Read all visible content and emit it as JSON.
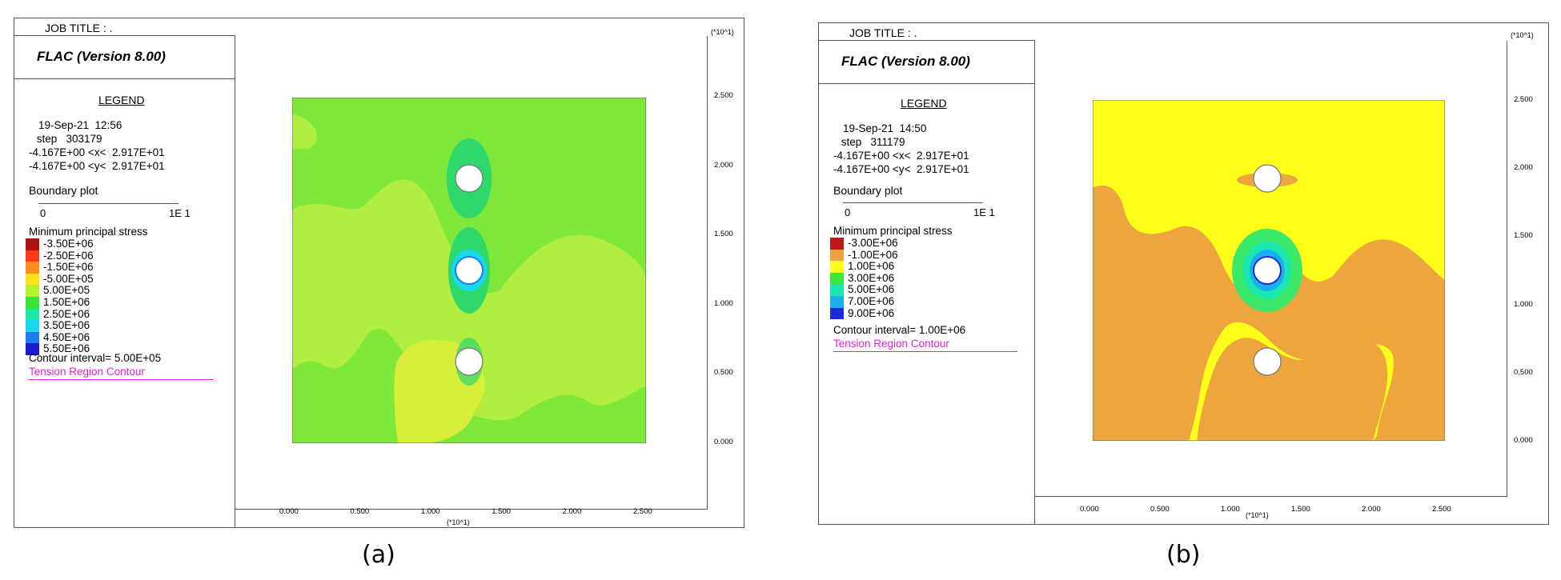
{
  "captions": [
    "(a)",
    "(b)"
  ],
  "panels": [
    {
      "job_title": "JOB TITLE : .",
      "app_title": "FLAC (Version 8.00)",
      "legend_title": "LEGEND",
      "info_lines": [
        "19-Sep-21  12:56",
        " step   303179",
        "-4.167E+00 <x<  2.917E+01",
        "-4.167E+00 <y<  2.917E+01"
      ],
      "boundary_label": "Boundary plot",
      "scale_left": "0",
      "scale_right": "1E  1",
      "stress_title": "Minimum principal stress",
      "levels": [
        {
          "label": "-3.50E+06",
          "color": "#b01010"
        },
        {
          "label": "-2.50E+06",
          "color": "#ff3a1a"
        },
        {
          "label": "-1.50E+06",
          "color": "#ff8c1a"
        },
        {
          "label": "-5.00E+05",
          "color": "#ffe21a"
        },
        {
          "label": "5.00E+05",
          "color": "#b6f230"
        },
        {
          "label": "1.50E+06",
          "color": "#38e63a"
        },
        {
          "label": "2.50E+06",
          "color": "#1ae8a8"
        },
        {
          "label": "3.50E+06",
          "color": "#1ad8ee"
        },
        {
          "label": "4.50E+06",
          "color": "#1a7cf0"
        },
        {
          "label": "5.50E+06",
          "color": "#1a1ad0"
        }
      ],
      "contour_interval": "Contour interval=  5.00E+05",
      "tension_label": "Tension Region Contour",
      "y_unit": "(*10^1)",
      "x_unit": "(*10^1)",
      "y_ticks": [
        "2.500",
        "2.000",
        "1.500",
        "1.000",
        "0.500",
        "0.000"
      ],
      "x_ticks": [
        "0.000",
        "0.500",
        "1.000",
        "1.500",
        "2.000",
        "2.500"
      ],
      "base_color": "#7de83a",
      "zone_color": "#b2ee40",
      "zone2_color": "#d8ef3a",
      "hole_halo_color": "#2fd86a"
    },
    {
      "job_title": "JOB TITLE : .",
      "app_title": "FLAC (Version 8.00)",
      "legend_title": "LEGEND",
      "info_lines": [
        "19-Sep-21  14:50",
        " step   311179",
        "-4.167E+00 <x<  2.917E+01",
        "-4.167E+00 <y<  2.917E+01"
      ],
      "boundary_label": "Boundary plot",
      "scale_left": "0",
      "scale_right": "1E  1",
      "stress_title": "Minimum principal stress",
      "levels": [
        {
          "label": "-3.00E+06",
          "color": "#c01818"
        },
        {
          "label": "-1.00E+06",
          "color": "#f0a040"
        },
        {
          "label": "1.00E+06",
          "color": "#ffff1a"
        },
        {
          "label": "3.00E+06",
          "color": "#3ae83a"
        },
        {
          "label": "5.00E+06",
          "color": "#1ae8b0"
        },
        {
          "label": "7.00E+06",
          "color": "#1ab0f0"
        },
        {
          "label": "9.00E+06",
          "color": "#1a2ad8"
        }
      ],
      "contour_interval": "Contour interval=  1.00E+06",
      "tension_label": "Tension Region Contour",
      "y_unit": "(*10^1)",
      "x_unit": "(*10^1)",
      "y_ticks": [
        "2.500",
        "2.000",
        "1.500",
        "1.000",
        "0.500",
        "0.000"
      ],
      "x_ticks": [
        "0.000",
        "0.500",
        "1.000",
        "1.500",
        "2.000",
        "2.500"
      ],
      "base_color": "#ffff1a",
      "zone_color": "#efa53e",
      "zone2_color": "#f3c043",
      "hole_halo_color": "#3ae86a"
    }
  ]
}
